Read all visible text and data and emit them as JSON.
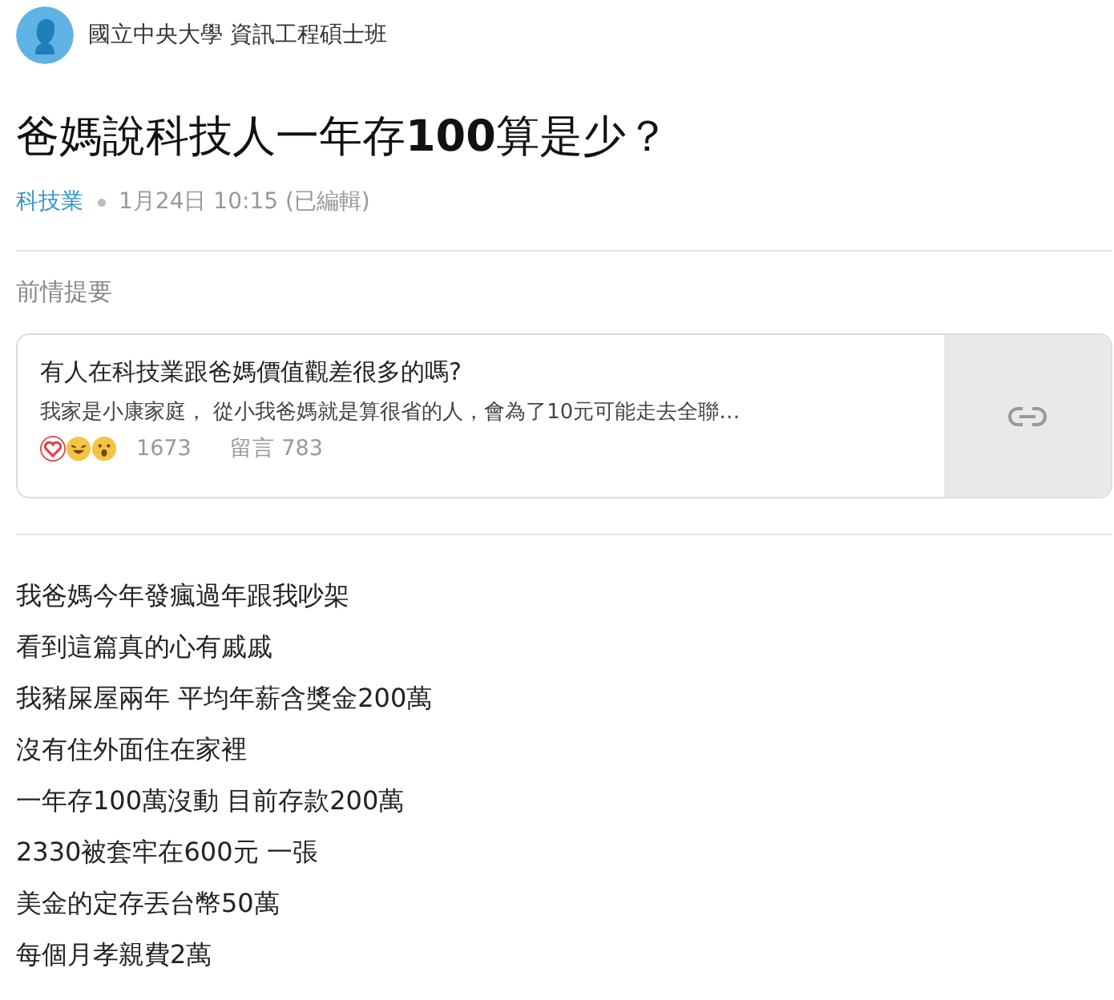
{
  "author": {
    "name": "國立中央大學 資訊工程碩士班"
  },
  "post": {
    "title": "爸媽說科技人一年存**100**算是少？",
    "category": "科技業",
    "time": "1月24日 10:15 (已編輯)"
  },
  "reference": {
    "heading": "前情提要",
    "card": {
      "title": "有人在科技業跟爸媽價值觀差很多的嗎?",
      "excerpt": "我家是小康家庭， 從小我爸媽就是算很省的人，會為了10元可能走去全聯…",
      "reactions": [
        {
          "kind": "heart"
        },
        {
          "kind": "laugh"
        },
        {
          "kind": "surprise"
        }
      ],
      "likes": "1673",
      "comments": "留言 783"
    }
  },
  "body": [
    "我爸媽今年發瘋過年跟我吵架",
    "看到這篇真的心有戚戚",
    "我豬屎屋兩年 平均年薪含獎金200萬",
    "沒有住外面住在家裡",
    "一年存100萬沒動 目前存款200萬",
    "2330被套牢在600元 一張",
    "美金的定存丟台幣50萬",
    "每個月孝親費2萬"
  ]
}
